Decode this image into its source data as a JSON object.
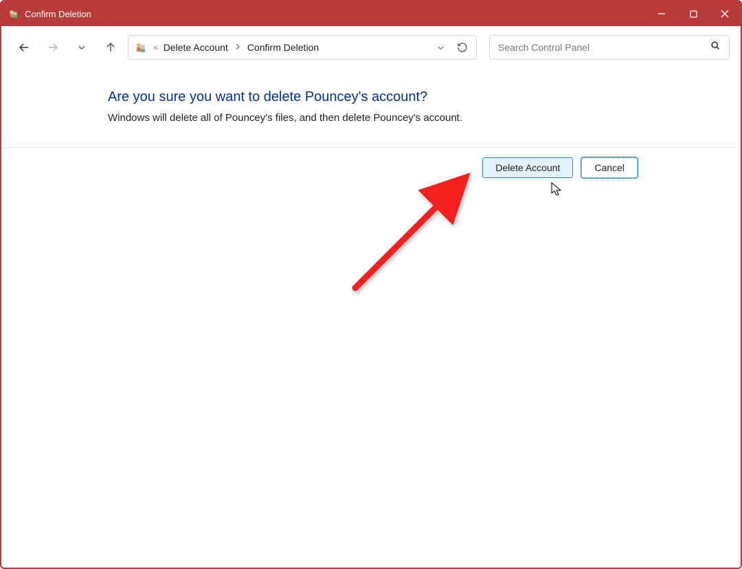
{
  "titlebar": {
    "title": "Confirm Deletion"
  },
  "breadcrumb": {
    "item1": "Delete Account",
    "item2": "Confirm Deletion"
  },
  "search": {
    "placeholder": "Search Control Panel"
  },
  "main": {
    "heading": "Are you sure you want to delete Pouncey's account?",
    "subtext": "Windows will delete all of Pouncey's files, and then delete Pouncey's account."
  },
  "buttons": {
    "delete": "Delete Account",
    "cancel": "Cancel"
  }
}
